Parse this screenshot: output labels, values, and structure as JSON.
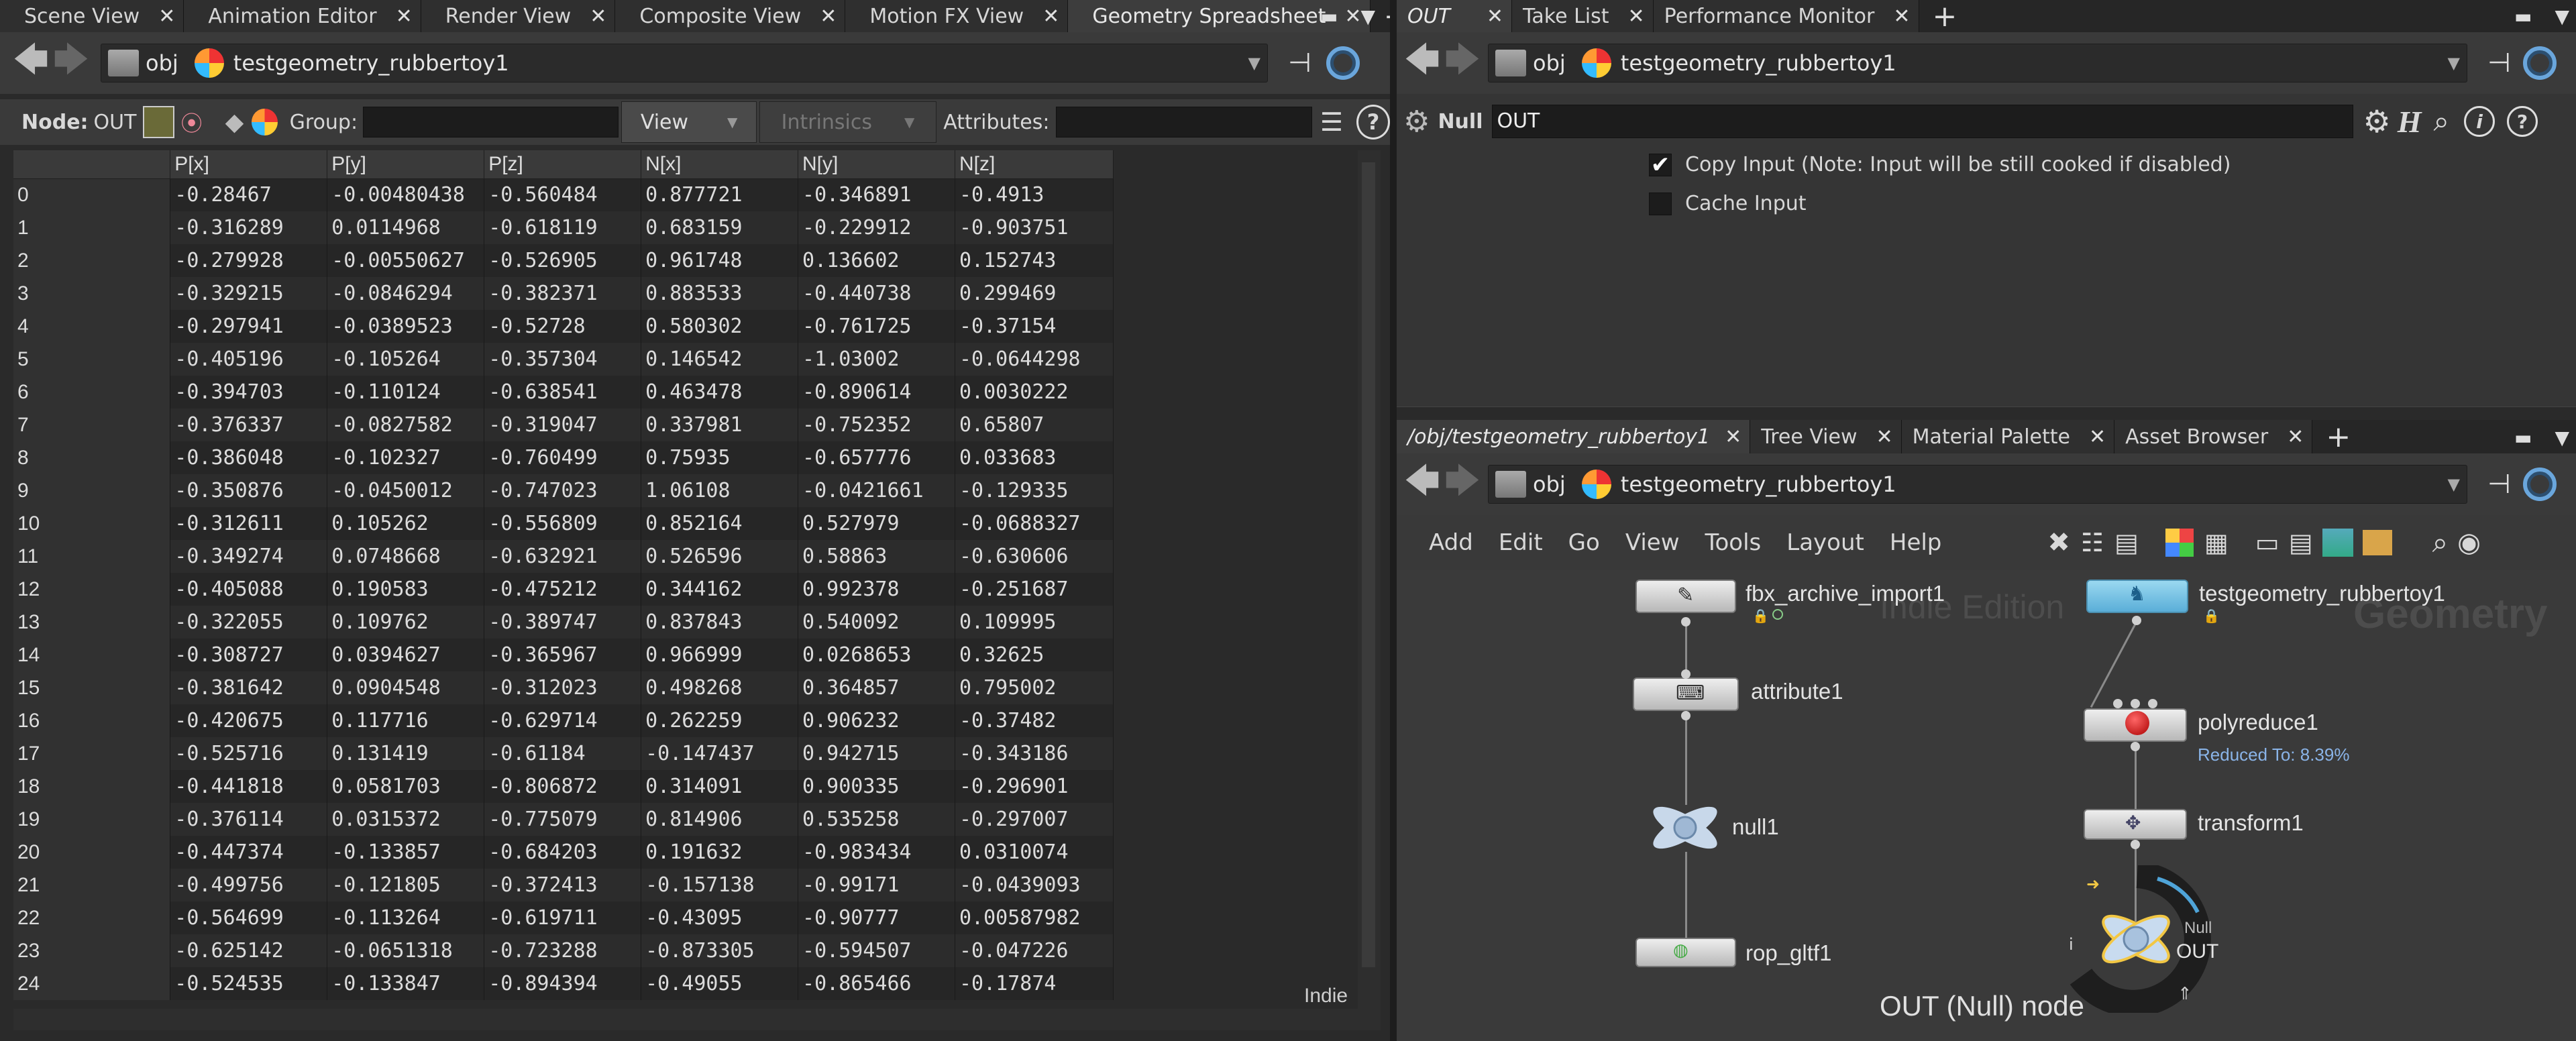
{
  "left_pane": {
    "tabs": [
      "Scene View",
      "Animation Editor",
      "Render View",
      "Composite View",
      "Motion FX View",
      "Geometry Spreadsheet"
    ],
    "path": {
      "root": "obj",
      "node": "testgeometry_rubbertoy1"
    },
    "toolbar": {
      "node_label": "Node:",
      "node_value": "OUT",
      "group_label": "Group:",
      "view_label": "View",
      "intrinsics_label": "Intrinsics",
      "attributes_label": "Attributes:"
    },
    "spreadsheet": {
      "columns": [
        "",
        "P[x]",
        "P[y]",
        "P[z]",
        "N[x]",
        "N[y]",
        "N[z]"
      ],
      "rows": [
        [
          "0",
          "-0.28467",
          "-0.00480438",
          "-0.560484",
          "0.877721",
          "-0.346891",
          "-0.4913"
        ],
        [
          "1",
          "-0.316289",
          "0.0114968",
          "-0.618119",
          "0.683159",
          "-0.229912",
          "-0.903751"
        ],
        [
          "2",
          "-0.279928",
          "-0.00550627",
          "-0.526905",
          "0.961748",
          "0.136602",
          "0.152743"
        ],
        [
          "3",
          "-0.329215",
          "-0.0846294",
          "-0.382371",
          "0.883533",
          "-0.440738",
          "0.299469"
        ],
        [
          "4",
          "-0.297941",
          "-0.0389523",
          "-0.52728",
          "0.580302",
          "-0.761725",
          "-0.37154"
        ],
        [
          "5",
          "-0.405196",
          "-0.105264",
          "-0.357304",
          "0.146542",
          "-1.03002",
          "-0.0644298"
        ],
        [
          "6",
          "-0.394703",
          "-0.110124",
          "-0.638541",
          "0.463478",
          "-0.890614",
          "0.0030222"
        ],
        [
          "7",
          "-0.376337",
          "-0.0827582",
          "-0.319047",
          "0.337981",
          "-0.752352",
          "0.65807"
        ],
        [
          "8",
          "-0.386048",
          "-0.102327",
          "-0.760499",
          "0.75935",
          "-0.657776",
          "0.033683"
        ],
        [
          "9",
          "-0.350876",
          "-0.0450012",
          "-0.747023",
          "1.06108",
          "-0.0421661",
          "-0.129335"
        ],
        [
          "10",
          "-0.312611",
          "0.105262",
          "-0.556809",
          "0.852164",
          "0.527979",
          "-0.0688327"
        ],
        [
          "11",
          "-0.349274",
          "0.0748668",
          "-0.632921",
          "0.526596",
          "0.58863",
          "-0.630606"
        ],
        [
          "12",
          "-0.405088",
          "0.190583",
          "-0.475212",
          "0.344162",
          "0.992378",
          "-0.251687"
        ],
        [
          "13",
          "-0.322055",
          "0.109762",
          "-0.389747",
          "0.837843",
          "0.540092",
          "0.109995"
        ],
        [
          "14",
          "-0.308727",
          "0.0394627",
          "-0.365967",
          "0.966999",
          "0.0268653",
          "0.32625"
        ],
        [
          "15",
          "-0.381642",
          "0.0904548",
          "-0.312023",
          "0.498268",
          "0.364857",
          "0.795002"
        ],
        [
          "16",
          "-0.420675",
          "0.117716",
          "-0.629714",
          "0.262259",
          "0.906232",
          "-0.37482"
        ],
        [
          "17",
          "-0.525716",
          "0.131419",
          "-0.61184",
          "-0.147437",
          "0.942715",
          "-0.343186"
        ],
        [
          "18",
          "-0.441818",
          "0.0581703",
          "-0.806872",
          "0.314091",
          "0.900335",
          "-0.296901"
        ],
        [
          "19",
          "-0.376114",
          "0.0315372",
          "-0.775079",
          "0.814906",
          "0.535258",
          "-0.297007"
        ],
        [
          "20",
          "-0.447374",
          "-0.133857",
          "-0.684203",
          "0.191632",
          "-0.983434",
          "0.0310074"
        ],
        [
          "21",
          "-0.499756",
          "-0.121805",
          "-0.372413",
          "-0.157138",
          "-0.99171",
          "-0.0439093"
        ],
        [
          "22",
          "-0.564699",
          "-0.113264",
          "-0.619711",
          "-0.43095",
          "-0.90777",
          "0.00587982"
        ],
        [
          "23",
          "-0.625142",
          "-0.0651318",
          "-0.723288",
          "-0.873305",
          "-0.594507",
          "-0.047226"
        ],
        [
          "24",
          "-0.524535",
          "-0.133847",
          "-0.894394",
          "-0.49055",
          "-0.865466",
          "-0.17874"
        ]
      ]
    },
    "watermark": "Indie"
  },
  "right_top_pane": {
    "tabs": [
      "OUT",
      "Take List",
      "Performance Monitor"
    ],
    "path": {
      "root": "obj",
      "node": "testgeometry_rubbertoy1"
    },
    "param_header": {
      "type_label": "Null",
      "name_value": "OUT"
    },
    "params": {
      "copy_input": "Copy Input (Note: Input will be still cooked if disabled)",
      "copy_input_checked": true,
      "cache_input": "Cache Input",
      "cache_input_checked": false
    }
  },
  "right_bottom_pane": {
    "tabs": [
      "/obj/testgeometry_rubbertoy1",
      "Tree View",
      "Material Palette",
      "Asset Browser"
    ],
    "path": {
      "root": "obj",
      "node": "testgeometry_rubbertoy1"
    },
    "menu": [
      "Add",
      "Edit",
      "Go",
      "View",
      "Tools",
      "Layout",
      "Help"
    ],
    "network": {
      "watermark_edition": "Indie Edition",
      "watermark_context": "Geometry",
      "nodes": {
        "fbx_archive_import1": "fbx_archive_import1",
        "attribute1": "attribute1",
        "null1": "null1",
        "rop_gltf1": "rop_gltf1",
        "testgeometry_rubbertoy1": "testgeometry_rubbertoy1",
        "polyreduce1": "polyreduce1",
        "polyreduce_info": "Reduced To: 8.39%",
        "transform1": "transform1",
        "out_type": "Null",
        "out_name": "OUT"
      },
      "status": "OUT (Null) node"
    }
  },
  "colors": {
    "accent_blue": "#6aa6dc",
    "status_blue": "#8ab4e8"
  }
}
